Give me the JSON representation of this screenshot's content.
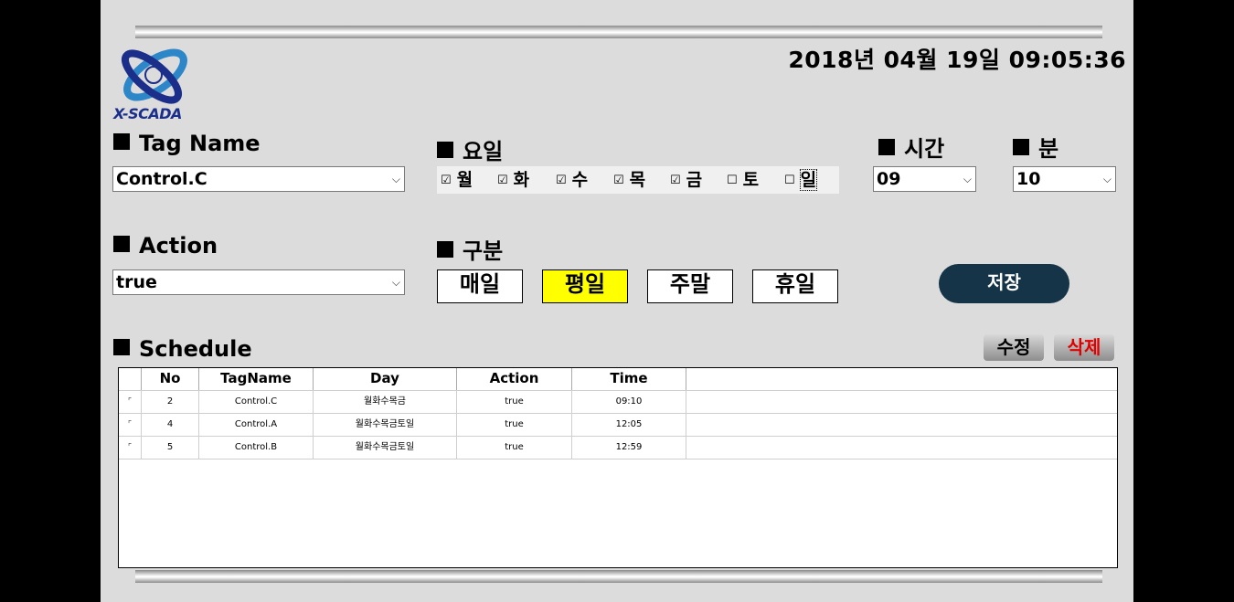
{
  "datetime": "2018년 04월 19일 09:05:36",
  "logo": {
    "text": "X-SCADA"
  },
  "tag_name": {
    "label": "Tag Name",
    "value": "Control.C"
  },
  "weekday": {
    "label": "요일",
    "days": [
      {
        "label": "월",
        "checked": true
      },
      {
        "label": "화",
        "checked": true
      },
      {
        "label": "수",
        "checked": true
      },
      {
        "label": "목",
        "checked": true
      },
      {
        "label": "금",
        "checked": true
      },
      {
        "label": "토",
        "checked": false
      },
      {
        "label": "일",
        "checked": false
      }
    ]
  },
  "hour": {
    "label": "시간",
    "value": "09"
  },
  "minute": {
    "label": "분",
    "value": "10"
  },
  "action": {
    "label": "Action",
    "value": "true"
  },
  "category": {
    "label": "구분",
    "buttons": [
      {
        "label": "매일",
        "active": false
      },
      {
        "label": "평일",
        "active": true
      },
      {
        "label": "주말",
        "active": false
      },
      {
        "label": "휴일",
        "active": false
      }
    ]
  },
  "save_label": "저장",
  "schedule": {
    "label": "Schedule",
    "edit_label": "수정",
    "delete_label": "삭제",
    "columns": [
      "No",
      "TagName",
      "Day",
      "Action",
      "Time"
    ],
    "rows": [
      {
        "no": "2",
        "tag": "Control.C",
        "day": "월화수목금",
        "action": "true",
        "time": "09:10"
      },
      {
        "no": "4",
        "tag": "Control.A",
        "day": "월화수목금토일",
        "action": "true",
        "time": "12:05"
      },
      {
        "no": "5",
        "tag": "Control.B",
        "day": "월화수목금토일",
        "action": "true",
        "time": "12:59"
      }
    ]
  },
  "colors": {
    "panel": "#dcdcdc",
    "active_button": "#ffff00",
    "save_button": "#163447",
    "delete_text": "#e00000"
  }
}
